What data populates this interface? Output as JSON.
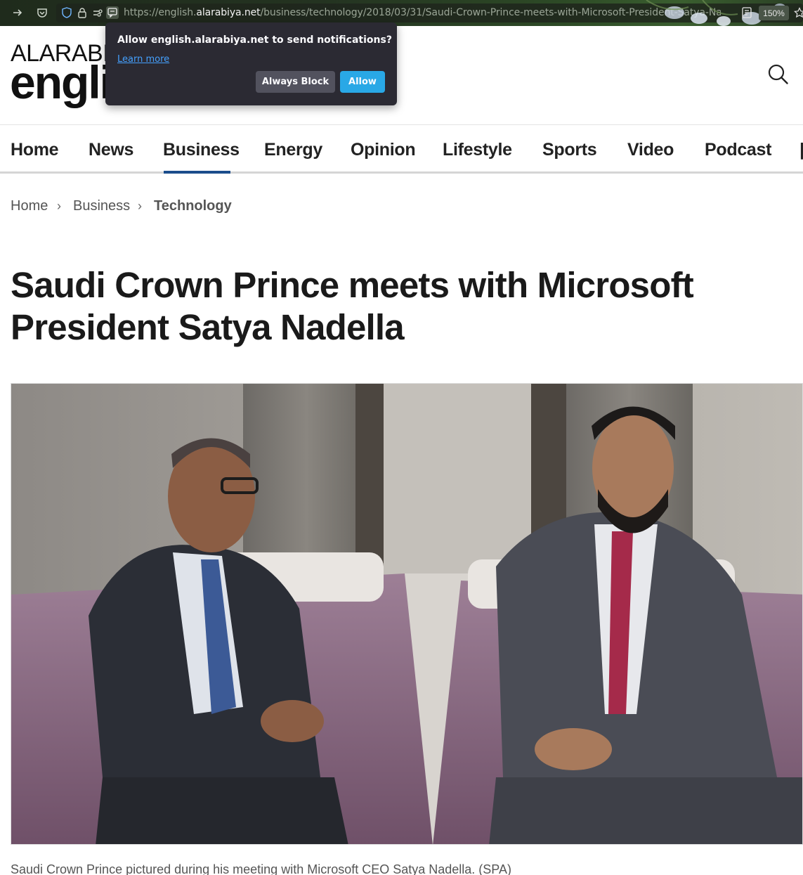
{
  "browser": {
    "url_prefix": "https://english.",
    "url_host": "alarabiya.net",
    "url_path": "/business/technology/2018/03/31/Saudi-Crown-Prince-meets-with-Microsoft-President-Satya-Nadella",
    "zoom": "150%"
  },
  "notification": {
    "message": "Allow english.alarabiya.net to send notifications?",
    "learn_more": "Learn more",
    "block_label": "Always Block",
    "allow_label": "Allow"
  },
  "site": {
    "logo_top": "ALARABI",
    "logo_bottom": "englis"
  },
  "nav": {
    "items": [
      {
        "label": "Home"
      },
      {
        "label": "News"
      },
      {
        "label": "Business"
      },
      {
        "label": "Energy"
      },
      {
        "label": "Opinion"
      },
      {
        "label": "Lifestyle"
      },
      {
        "label": "Sports"
      },
      {
        "label": "Video"
      },
      {
        "label": "Podcast"
      }
    ],
    "active": "Business"
  },
  "breadcrumb": {
    "items": [
      "Home",
      "Business",
      "Technology"
    ],
    "separator": "›"
  },
  "article": {
    "title": "Saudi Crown Prince meets with Microsoft President Satya Nadella",
    "caption": "Saudi Crown Prince pictured during his meeting with Microsoft CEO Satya Nadella. (SPA)"
  }
}
